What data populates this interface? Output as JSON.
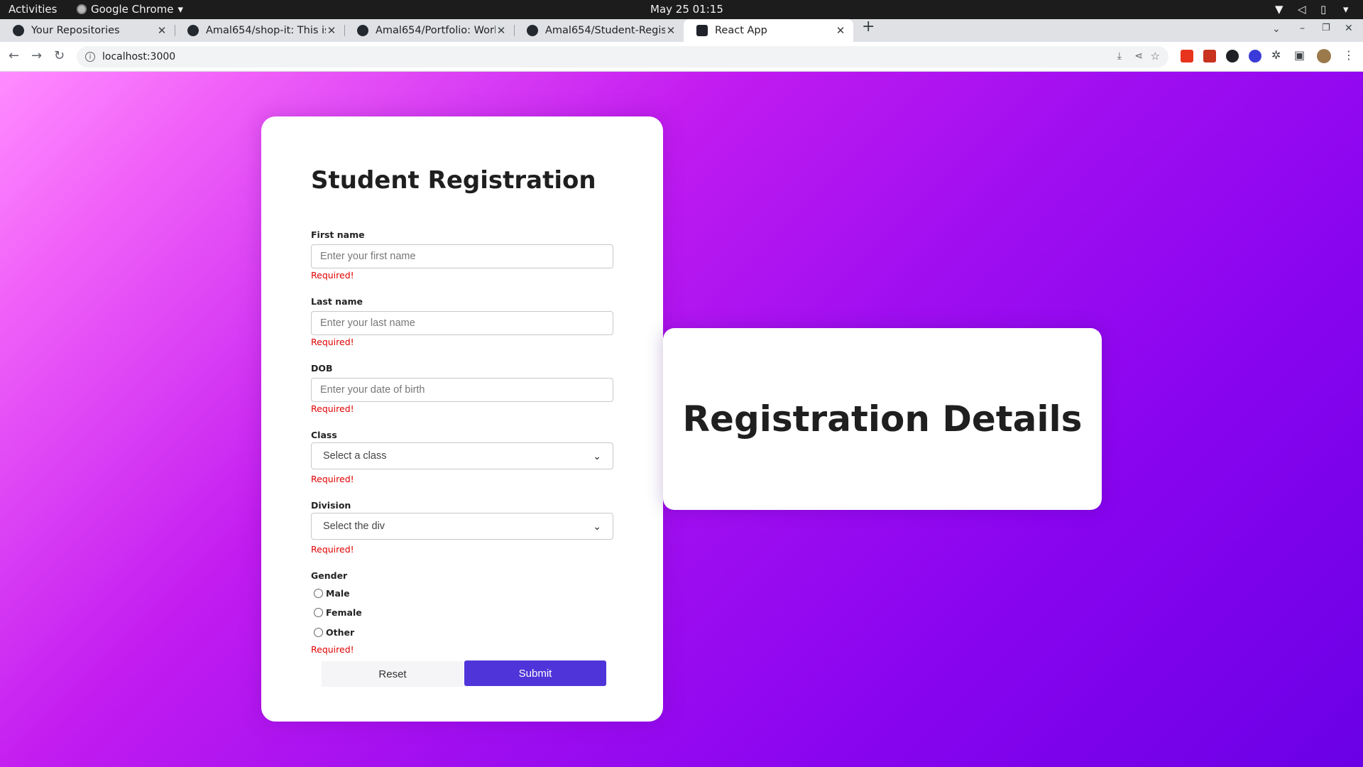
{
  "os": {
    "activities": "Activities",
    "app_name": "Google Chrome",
    "clock": "May 25  01:15"
  },
  "browser": {
    "tabs": [
      {
        "title": "Your Repositories",
        "icon": "github-icon"
      },
      {
        "title": "Amal654/shop-it: This is a",
        "icon": "github-icon"
      },
      {
        "title": "Amal654/Portfolio: Worki",
        "icon": "github-icon"
      },
      {
        "title": "Amal654/Student-Registr",
        "icon": "github-icon"
      },
      {
        "title": "React App",
        "icon": "react-icon"
      }
    ],
    "active_tab": 4,
    "url": "localhost:3000"
  },
  "form": {
    "title": "Student Registration",
    "first_name": {
      "label": "First name",
      "placeholder": "Enter your first name",
      "value": "",
      "error": "Required!"
    },
    "last_name": {
      "label": "Last name",
      "placeholder": "Enter your last name",
      "value": "",
      "error": "Required!"
    },
    "dob": {
      "label": "DOB",
      "placeholder": "Enter your date of birth",
      "value": "",
      "error": "Required!"
    },
    "class": {
      "label": "Class",
      "selected": "Select a class",
      "error": "Required!"
    },
    "division": {
      "label": "Division",
      "selected": "Select the div",
      "error": "Required!"
    },
    "gender": {
      "label": "Gender",
      "options": [
        "Male",
        "Female",
        "Other"
      ],
      "error": "Required!"
    },
    "reset_label": "Reset",
    "submit_label": "Submit"
  },
  "details": {
    "title": "Registration Details"
  },
  "colors": {
    "accent": "#4f35d9",
    "error": "#e00000",
    "gradient_start": "#ff8cff",
    "gradient_end": "#6a00e6"
  }
}
